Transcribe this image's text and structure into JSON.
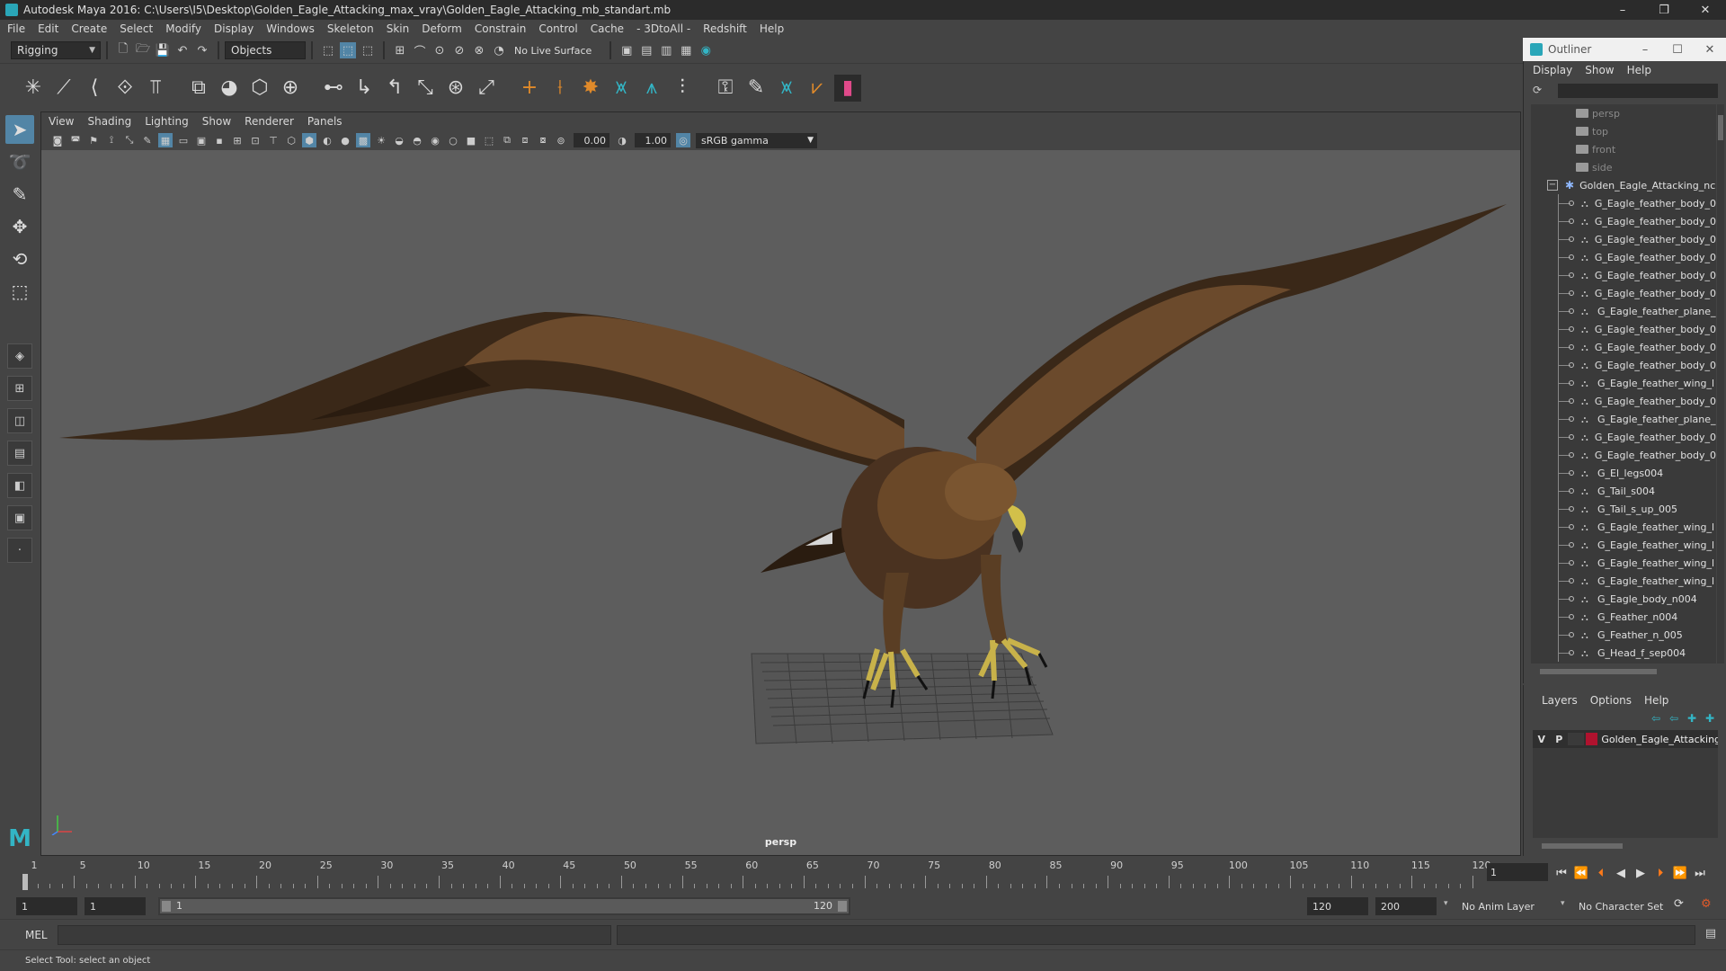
{
  "titlebar": {
    "title": "Autodesk Maya 2016: C:\\Users\\I5\\Desktop\\Golden_Eagle_Attacking_max_vray\\Golden_Eagle_Attacking_mb_standart.mb",
    "minimize": "–",
    "maximize": "❐",
    "close": "✕"
  },
  "menubar": {
    "items": [
      "File",
      "Edit",
      "Create",
      "Select",
      "Modify",
      "Display",
      "Windows",
      "Skeleton",
      "Skin",
      "Deform",
      "Constrain",
      "Control",
      "Cache",
      "- 3DtoAll -",
      "Redshift",
      "Help"
    ]
  },
  "statusline": {
    "menuset": "Rigging",
    "selection_mode": "Objects",
    "live_surface": "No Live Surface"
  },
  "viewport": {
    "menu": [
      "View",
      "Shading",
      "Lighting",
      "Show",
      "Renderer",
      "Panels"
    ],
    "exposure": "0.00",
    "gamma_value": "1.00",
    "color_space": "sRGB gamma",
    "camera_label": "persp"
  },
  "outliner": {
    "title": "Outliner",
    "minimize": "–",
    "maximize": "☐",
    "close": "✕",
    "menu": [
      "Display",
      "Show",
      "Help"
    ],
    "cameras": [
      "persp",
      "top",
      "front",
      "side"
    ],
    "group": "Golden_Eagle_Attacking_nc",
    "children": [
      "G_Eagle_feather_body_0",
      "G_Eagle_feather_body_0",
      "G_Eagle_feather_body_0",
      "G_Eagle_feather_body_0",
      "G_Eagle_feather_body_0",
      "G_Eagle_feather_body_0",
      "G_Eagle_feather_plane_",
      "G_Eagle_feather_body_0",
      "G_Eagle_feather_body_0",
      "G_Eagle_feather_body_0",
      "G_Eagle_feather_wing_l",
      "G_Eagle_feather_body_0",
      "G_Eagle_feather_plane_",
      "G_Eagle_feather_body_0",
      "G_Eagle_feather_body_0",
      "G_El_legs004",
      "G_Tail_s004",
      "G_Tail_s_up_005",
      "G_Eagle_feather_wing_l",
      "G_Eagle_feather_wing_l",
      "G_Eagle_feather_wing_l",
      "G_Eagle_feather_wing_l",
      "G_Eagle_body_n004",
      "G_Feather_n004",
      "G_Feather_n_005",
      "G_Head_f_sep004"
    ]
  },
  "layers": {
    "menu": [
      "Layers",
      "Options",
      "Help"
    ],
    "layer": {
      "visible": "V",
      "playback": "P",
      "name": "Golden_Eagle_Attacking",
      "color": "#b0122e"
    }
  },
  "timeslider": {
    "ticks": [
      "1",
      "5",
      "10",
      "15",
      "20",
      "25",
      "30",
      "35",
      "40",
      "45",
      "50",
      "55",
      "60",
      "65",
      "70",
      "75",
      "80",
      "85",
      "90",
      "95",
      "100",
      "105",
      "110",
      "115",
      "120"
    ],
    "current_frame": "1",
    "current_time": 1
  },
  "rangeslider": {
    "start_time": "1",
    "playback_start": "1",
    "range_start": "1",
    "range_end": "120",
    "playback_end": "120",
    "end_time": "200",
    "anim_layer": "No Anim Layer",
    "character_set": "No Character Set"
  },
  "cmdline": {
    "language": "MEL"
  },
  "helpline": {
    "text": "Select Tool: select an object"
  }
}
